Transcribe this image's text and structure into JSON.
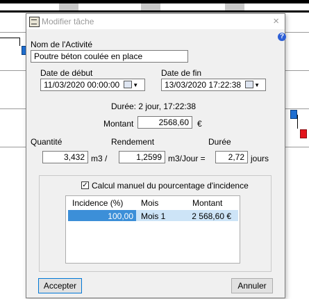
{
  "dialog": {
    "title": "Modifier tâche",
    "close": "×",
    "help": "?",
    "activity_label": "Nom de l'Activité",
    "activity_value": "Poutre béton coulée en place",
    "start_label": "Date de début",
    "start_value": "11/03/2020 00:00:00",
    "end_label": "Date de fin",
    "end_value": "13/03/2020 17:22:38",
    "duration_text": "Durée: 2 jour, 17:22:38",
    "amount_label": "Montant",
    "amount_value": "2568,60",
    "currency": "€",
    "quantity_label": "Quantité",
    "rendement_label": "Rendement",
    "duree_label": "Durée",
    "quantity_value": "3,432",
    "quantity_unit": "m3 /",
    "rendement_value": "1,2599",
    "rendement_unit": "m3/Jour =",
    "duree_value": "2,72",
    "duree_unit": "jours",
    "checkbox_label": "Calcul manuel du pourcentage d'incidence",
    "checkbox_mark": "✓",
    "table": {
      "headers": [
        "Incidence (%)",
        "Mois",
        "Montant"
      ],
      "rows": [
        [
          "100,00",
          "Mois 1",
          "2 568,60 €"
        ]
      ]
    },
    "accept_label": "Accepter",
    "cancel_label": "Annuler"
  }
}
